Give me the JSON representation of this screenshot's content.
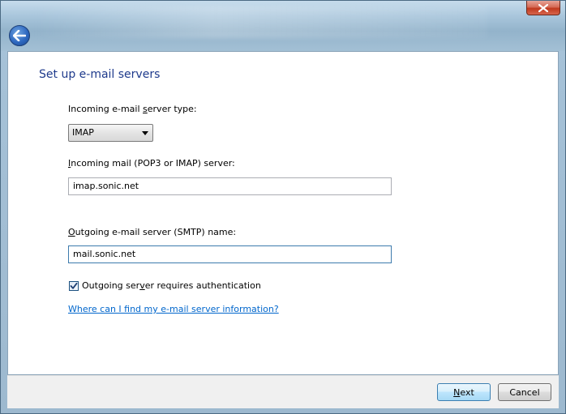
{
  "window": {
    "close_glyph": "close-icon",
    "back_glyph": "back-arrow-icon"
  },
  "page": {
    "title": "Set up e-mail servers"
  },
  "incoming_type": {
    "label_pre": "Incoming e-mail ",
    "label_accel": "s",
    "label_post": "erver type:",
    "selected": "IMAP"
  },
  "incoming_server": {
    "label_accel": "I",
    "label_post": "ncoming mail (POP3 or IMAP) server:",
    "value": "imap.sonic.net"
  },
  "outgoing_server": {
    "label_accel": "O",
    "label_post": "utgoing e-mail server (SMTP) name:",
    "value": "mail.sonic.net"
  },
  "auth": {
    "checked": true,
    "label_pre": "Outgoing ser",
    "label_accel": "v",
    "label_post": "er requires authentication"
  },
  "help_link": "Where can I find my e-mail server information?",
  "footer": {
    "next_accel": "N",
    "next_post": "ext",
    "cancel_label": "Cancel"
  }
}
